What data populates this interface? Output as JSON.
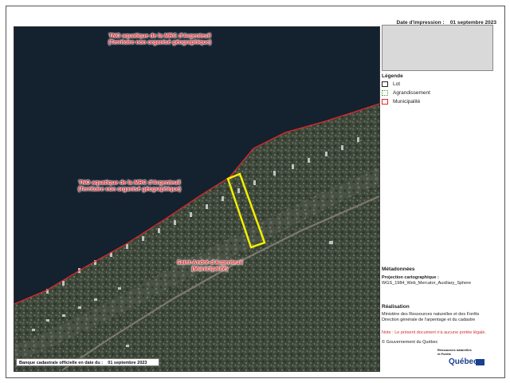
{
  "map": {
    "labels": {
      "tno_top_name": "TNO aquatique de la MRC d'Argenteuil",
      "tno_top_sub": "(Territoire non organisé géographique)",
      "tno_mid_name": "TNO aquatique de la MRC d'Argenteuil",
      "tno_mid_sub": "(Territoire non organisé géographique)",
      "muni_name": "Saint-André-d'Argenteuil",
      "muni_sub": "(Municipalité)"
    },
    "colors": {
      "water": "#13202e",
      "forest": "#3b4437",
      "municipality_line": "#e0262a",
      "lot_outline": "#f4f000"
    }
  },
  "cadastre_bar": {
    "text": "Banque cadastrale officielle en date du :",
    "date": "01 septembre 2023"
  },
  "side": {
    "print_date_label": "Date d'impression :",
    "print_date_value": "01 septembre 2023",
    "legend": {
      "title": "Légende",
      "items": [
        {
          "label": "Lot",
          "icon": "lot-swatch-icon"
        },
        {
          "label": "Agrandissement",
          "icon": "agrandissement-swatch-icon"
        },
        {
          "label": "Municipalité",
          "icon": "municipalite-swatch-icon"
        }
      ]
    },
    "metadata": {
      "title": "Métadonnées",
      "projection_label": "Projection cartographique :",
      "projection_value": "WGS_1984_Web_Mercator_Auxiliary_Sphere"
    },
    "realisation": {
      "title": "Réalisation",
      "line1": "Ministère des Ressources naturelles et des Forêts",
      "line2": "Direction générale de l'arpentage et du cadastre"
    },
    "note": "Note : Le présent document n'a aucune portée légale.",
    "copyright": "© Gouvernement du Québec",
    "logo": {
      "small_line1": "Ressources naturelles",
      "small_line2": "et Forêts",
      "main": "Québec"
    }
  }
}
